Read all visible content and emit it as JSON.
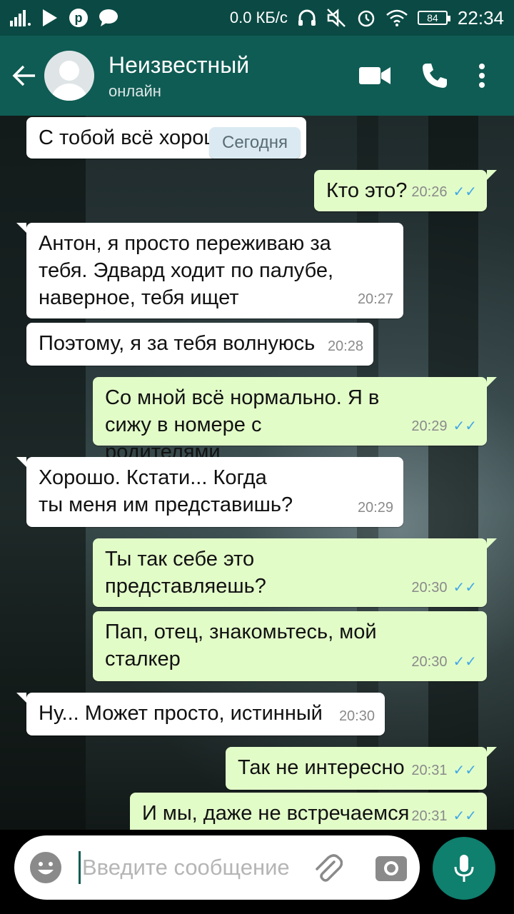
{
  "status_bar": {
    "speed": "0.0 КБ/с",
    "battery": "84",
    "time": "22:34"
  },
  "header": {
    "contact_name": "Неизвестный",
    "contact_status": "онлайн"
  },
  "date_pill": "Сегодня",
  "messages": [
    {
      "dir": "in",
      "text": "С тобой всё хорош",
      "time": ""
    },
    {
      "dir": "out",
      "text": "Кто это?",
      "time": "20:26"
    },
    {
      "dir": "in",
      "text": "Антон, я просто переживаю за тебя. Эдвард ходит по палубе, наверное, тебя ищет",
      "time": "20:27"
    },
    {
      "dir": "in",
      "text": "Поэтому, я за тебя волнуюсь",
      "time": "20:28"
    },
    {
      "dir": "out",
      "text": "Со мной всё нормально. Я в сижу в номере с родителями",
      "time": "20:29"
    },
    {
      "dir": "in",
      "text": "Хорошо. Кстати... Когда ты меня им представишь?",
      "time": "20:29"
    },
    {
      "dir": "out",
      "text": "Ты так себе это представляешь?",
      "time": "20:30"
    },
    {
      "dir": "out",
      "text": "Пап, отец, знакомьтесь, мой сталкер",
      "time": "20:30"
    },
    {
      "dir": "in",
      "text": "Ну... Может просто, истинный",
      "time": "20:30"
    },
    {
      "dir": "out",
      "text": "Так не интересно",
      "time": "20:31"
    },
    {
      "dir": "out",
      "text": "И мы, даже не встречаемся",
      "time": "20:31"
    }
  ],
  "composer": {
    "placeholder": "Введите сообщение"
  },
  "colors": {
    "header_bg": "#0f5c54",
    "status_bg": "#0b4a44",
    "outgoing_bubble": "#e2fcc8",
    "incoming_bubble": "#ffffff",
    "read_ticks": "#43a8e6",
    "mic_button": "#0f7f6e"
  },
  "icons": {
    "back": "arrow-left-icon",
    "video": "video-camera-icon",
    "call": "phone-icon",
    "menu": "more-vert-icon",
    "emoji": "smiley-icon",
    "attach": "paperclip-icon",
    "camera": "camera-icon",
    "mic": "microphone-icon"
  }
}
